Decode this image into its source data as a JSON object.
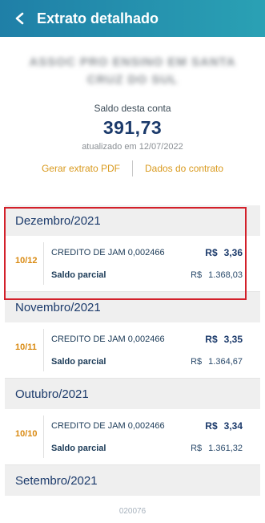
{
  "header": {
    "title": "Extrato detalhado"
  },
  "org": {
    "name_line1": "ASSOC PRO ENSINO EM SANTA",
    "name_line2": "CRUZ DO SUL"
  },
  "balance": {
    "label": "Saldo desta conta",
    "value": "391,73",
    "updated": "atualizado em 12/07/2022"
  },
  "links": {
    "pdf": "Gerar extrato PDF",
    "contract": "Dados do contrato"
  },
  "months": [
    {
      "title": "Dezembro/2021",
      "entries": [
        {
          "date": "10/12",
          "description": "CREDITO DE JAM 0,002466",
          "currency": "R$",
          "amount": "3,36",
          "partial_label": "Saldo parcial",
          "partial_currency": "R$",
          "partial_value": "1.368,03"
        }
      ]
    },
    {
      "title": "Novembro/2021",
      "entries": [
        {
          "date": "10/11",
          "description": "CREDITO DE JAM 0,002466",
          "currency": "R$",
          "amount": "3,35",
          "partial_label": "Saldo parcial",
          "partial_currency": "R$",
          "partial_value": "1.364,67"
        }
      ]
    },
    {
      "title": "Outubro/2021",
      "entries": [
        {
          "date": "10/10",
          "description": "CREDITO DE JAM 0,002466",
          "currency": "R$",
          "amount": "3,34",
          "partial_label": "Saldo parcial",
          "partial_currency": "R$",
          "partial_value": "1.361,32"
        }
      ]
    },
    {
      "title": "Setembro/2021",
      "entries": []
    }
  ],
  "footer": {
    "code": "020076"
  },
  "colors": {
    "header_start": "#1f7fa7",
    "header_end": "#2aa1b4",
    "accent": "#d99a1e",
    "date": "#d98a12",
    "highlight": "#d3202a",
    "value": "#1b3a6b"
  },
  "icons": {
    "back": "arrow-left-icon"
  }
}
